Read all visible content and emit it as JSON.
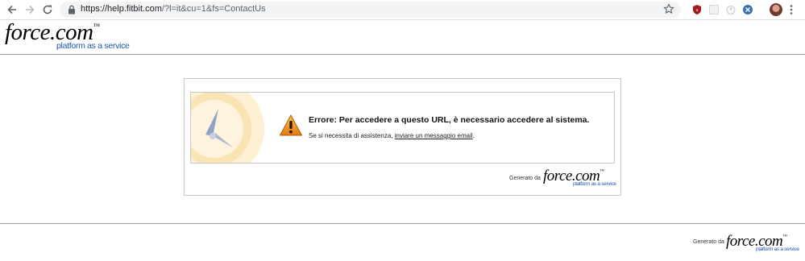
{
  "browser": {
    "url_main": "https://help.fitbit.com",
    "url_rest": "/?l=it&cu=1&fs=ContactUs"
  },
  "header": {
    "logo_text": "force.com",
    "logo_tm": "™",
    "logo_tagline": "platform as a service"
  },
  "error": {
    "title": "Errore: Per accedere a questo URL, è necessario accedere al sistema.",
    "message_prefix": "Se si necessita di assistenza, ",
    "message_link": "inviare un messaggio email",
    "message_suffix": "."
  },
  "generated_by": {
    "label": "Generato da",
    "logo_text": "force.com",
    "logo_tm": "™",
    "logo_tagline": "platform as a service"
  },
  "colors": {
    "tagline_blue": "#1a56a8",
    "warning_orange": "#e98a1f",
    "clock_bg": "#fbe7bd"
  }
}
